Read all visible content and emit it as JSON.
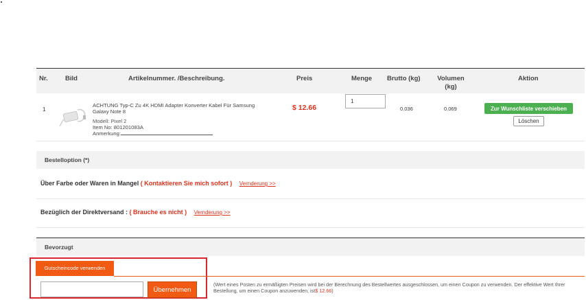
{
  "table": {
    "headers": [
      "Nr.",
      "Bild",
      "Artikelnummer. /Beschreibung.",
      "Preis",
      "Menge",
      "Brutto (kg)",
      "Volumen (kg)",
      "Aktion"
    ]
  },
  "item": {
    "nr": "1",
    "description": "ACHTUNG Typ-C Zu 4K HDMI Adapter Konverter Kabel Für Samsung Galaxy Note 8",
    "model": "Modell: Pixel 2",
    "item_no": "Item No: 801201083A",
    "note_label": "Anmerkung:",
    "price": "$ 12.66",
    "quantity": "1",
    "gross": "0.036",
    "volume": "0.069",
    "wishlist_label": "Zur Wunschliste verschieben",
    "delete_label": "Löschen"
  },
  "order_option": {
    "title": "Bestelloption (*)",
    "color_label": "Über Farbe oder Waren in Mangel",
    "color_value": "( Kontaktieren Sie mich sofort )",
    "change_link": "Vernderung >>",
    "direct_label": "Bezüglich der Direktversand :",
    "direct_value": "( Brauche es nicht )"
  },
  "preferred": {
    "title": "Bevorzugt",
    "coupon_tab": "Gutscheincode verwenden",
    "apply_label": "Übernehmen",
    "note_text": "(Wert eines Posten zu ermäßigten Preisen wird bei der Berechnung des Bestellwertes ausgeschlossen, um einen Coupon zu verwenden. Der effektive Wert Ihrer Bestellung, um einen Coupon anzuwenden, ist",
    "note_amount": "$ 12.66",
    "note_end": ")"
  },
  "colors": {
    "accent": "#f05a12",
    "price": "#d9321c",
    "wishlist": "#4caf50",
    "highlight": "#d8262e"
  }
}
